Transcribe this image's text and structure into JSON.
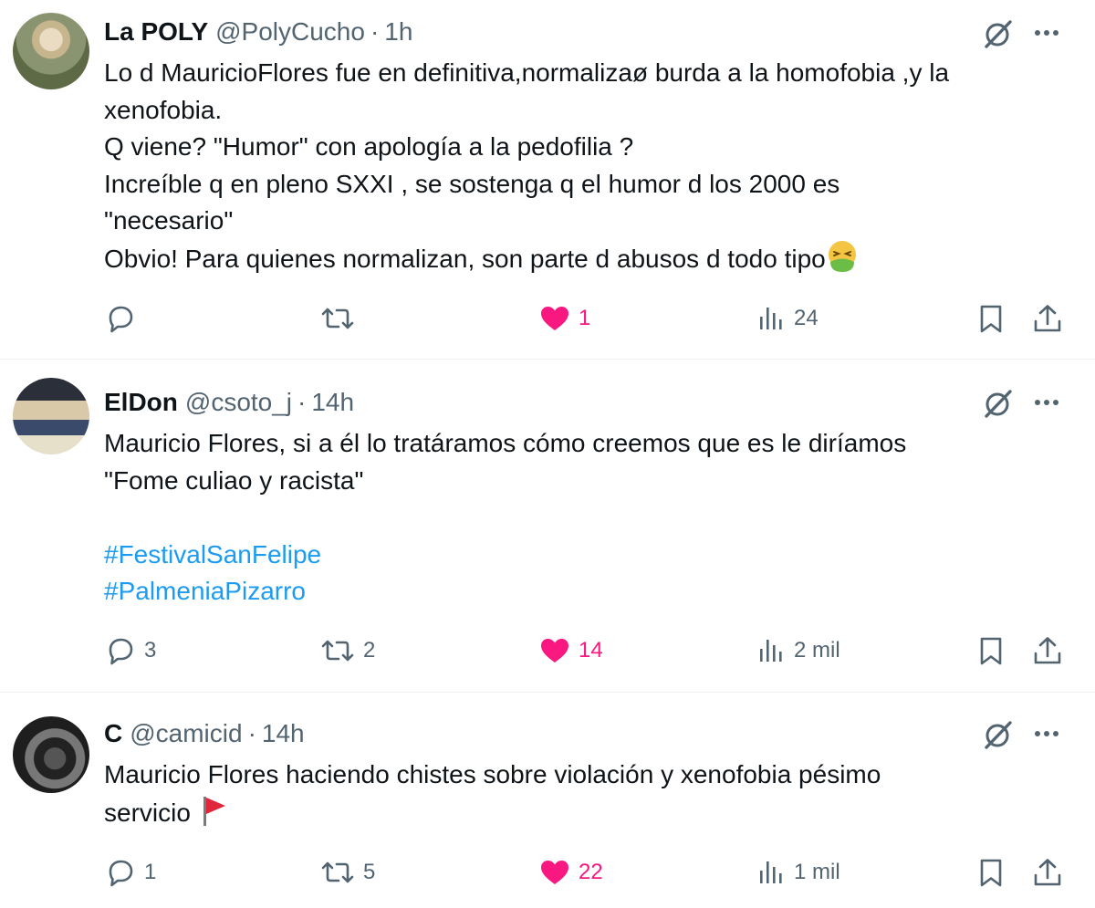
{
  "tweets": [
    {
      "name": "La POLY",
      "handle": "@PolyCucho",
      "separator": "·",
      "time": "1h",
      "lines": [
        "Lo d MauricioFlores fue en definitiva,normalizaø burda a la homofobia ,y  la",
        "xenofobia.",
        "Q viene? \"Humor\" con apología a la pedofilia ?",
        "Increíble q en pleno SXXI , se sostenga q el humor d los 2000 es",
        "\"necesario\"",
        "Obvio! Para quienes normalizan, son parte d abusos d todo tipo"
      ],
      "end_emoji": "nauseated-face-emoji",
      "replies": "",
      "retweets": "",
      "likes": "1",
      "views": "24"
    },
    {
      "name": "ElDon",
      "handle": "@csoto_j",
      "separator": "·",
      "time": "14h",
      "lines": [
        "Mauricio Flores, si a él lo tratáramos cómo creemos que es le diríamos",
        "\"Fome culiao y racista\""
      ],
      "hashtags": [
        "#FestivalSanFelipe",
        "#PalmeniaPizarro"
      ],
      "replies": "3",
      "retweets": "2",
      "likes": "14",
      "views": "2 mil"
    },
    {
      "name": "C",
      "handle": "@camicid",
      "separator": "·",
      "time": "14h",
      "lines": [
        "Mauricio Flores haciendo chistes sobre violación y xenofobia pésimo",
        "servicio"
      ],
      "end_emoji": "red-flag-emoji",
      "replies": "1",
      "retweets": "5",
      "likes": "22",
      "views": "1 mil"
    }
  ],
  "colors": {
    "text": "#0f1419",
    "muted": "#536471",
    "like": "#f91880",
    "link": "#1d9bf0",
    "divider": "#eff3f4"
  },
  "icons": [
    "grok-icon",
    "more-icon",
    "reply-icon",
    "retweet-icon",
    "heart-icon",
    "views-icon",
    "bookmark-icon",
    "share-icon"
  ]
}
